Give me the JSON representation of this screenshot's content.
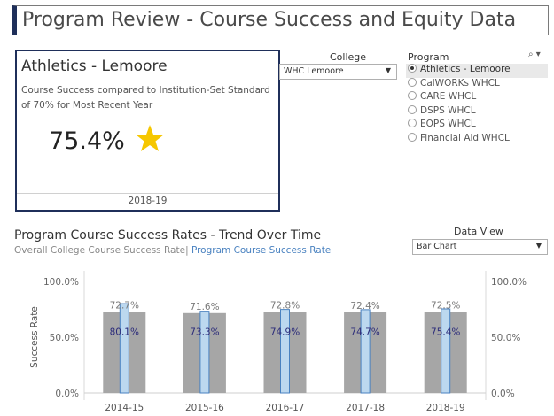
{
  "header": {
    "title": "Program Review - Course Success and Equity Data"
  },
  "kpi": {
    "program": "Athletics - Lemoore",
    "description": "Course Success compared to Institution-Set Standard of 70% for Most Recent Year",
    "value": "75.4%",
    "star_icon": "star-icon",
    "star_color": "#f6c700",
    "year": "2018-19"
  },
  "filters": {
    "college_label": "College",
    "college_value": "WHC Lemoore",
    "program_label": "Program",
    "program_tools": "⌕ ▾",
    "programs": [
      {
        "label": "Athletics - Lemoore",
        "selected": true
      },
      {
        "label": "CalWORKs WHCL",
        "selected": false
      },
      {
        "label": "CARE WHCL",
        "selected": false
      },
      {
        "label": "DSPS WHCL",
        "selected": false
      },
      {
        "label": "EOPS WHCL",
        "selected": false
      },
      {
        "label": "Financial Aid WHCL",
        "selected": false
      }
    ],
    "data_view_label": "Data View",
    "data_view_value": "Bar Chart"
  },
  "trend": {
    "title": "Program Course Success Rates - Trend Over Time",
    "legend_overall": "Overall College Course Success Rate",
    "legend_sep": "| ",
    "legend_program": "Program Course Success Rate"
  },
  "colors": {
    "overall": "#a6a6a6",
    "program_fill": "#bcd8ef",
    "program_stroke": "#4a82c0",
    "program_label": "#2b2b7a"
  },
  "chart_data": {
    "type": "bar",
    "categories": [
      "2014-15",
      "2015-16",
      "2016-17",
      "2017-18",
      "2018-19"
    ],
    "series": [
      {
        "name": "Overall College Course Success Rate",
        "values": [
          72.7,
          71.6,
          72.8,
          72.4,
          72.5
        ],
        "labels": [
          "72.7%",
          "71.6%",
          "72.8%",
          "72.4%",
          "72.5%"
        ]
      },
      {
        "name": "Program Course Success Rate",
        "values": [
          80.1,
          73.3,
          74.9,
          74.7,
          75.4
        ],
        "labels": [
          "80.1%",
          "73.3%",
          "74.9%",
          "74.7%",
          "75.4%"
        ]
      }
    ],
    "ylabel": "Success Rate",
    "ylim": [
      0,
      100
    ],
    "ticks": [
      "0.0%",
      "50.0%",
      "100.0%"
    ],
    "tick_values": [
      0,
      50,
      100
    ],
    "dual_axis_right": true,
    "grid": false
  }
}
